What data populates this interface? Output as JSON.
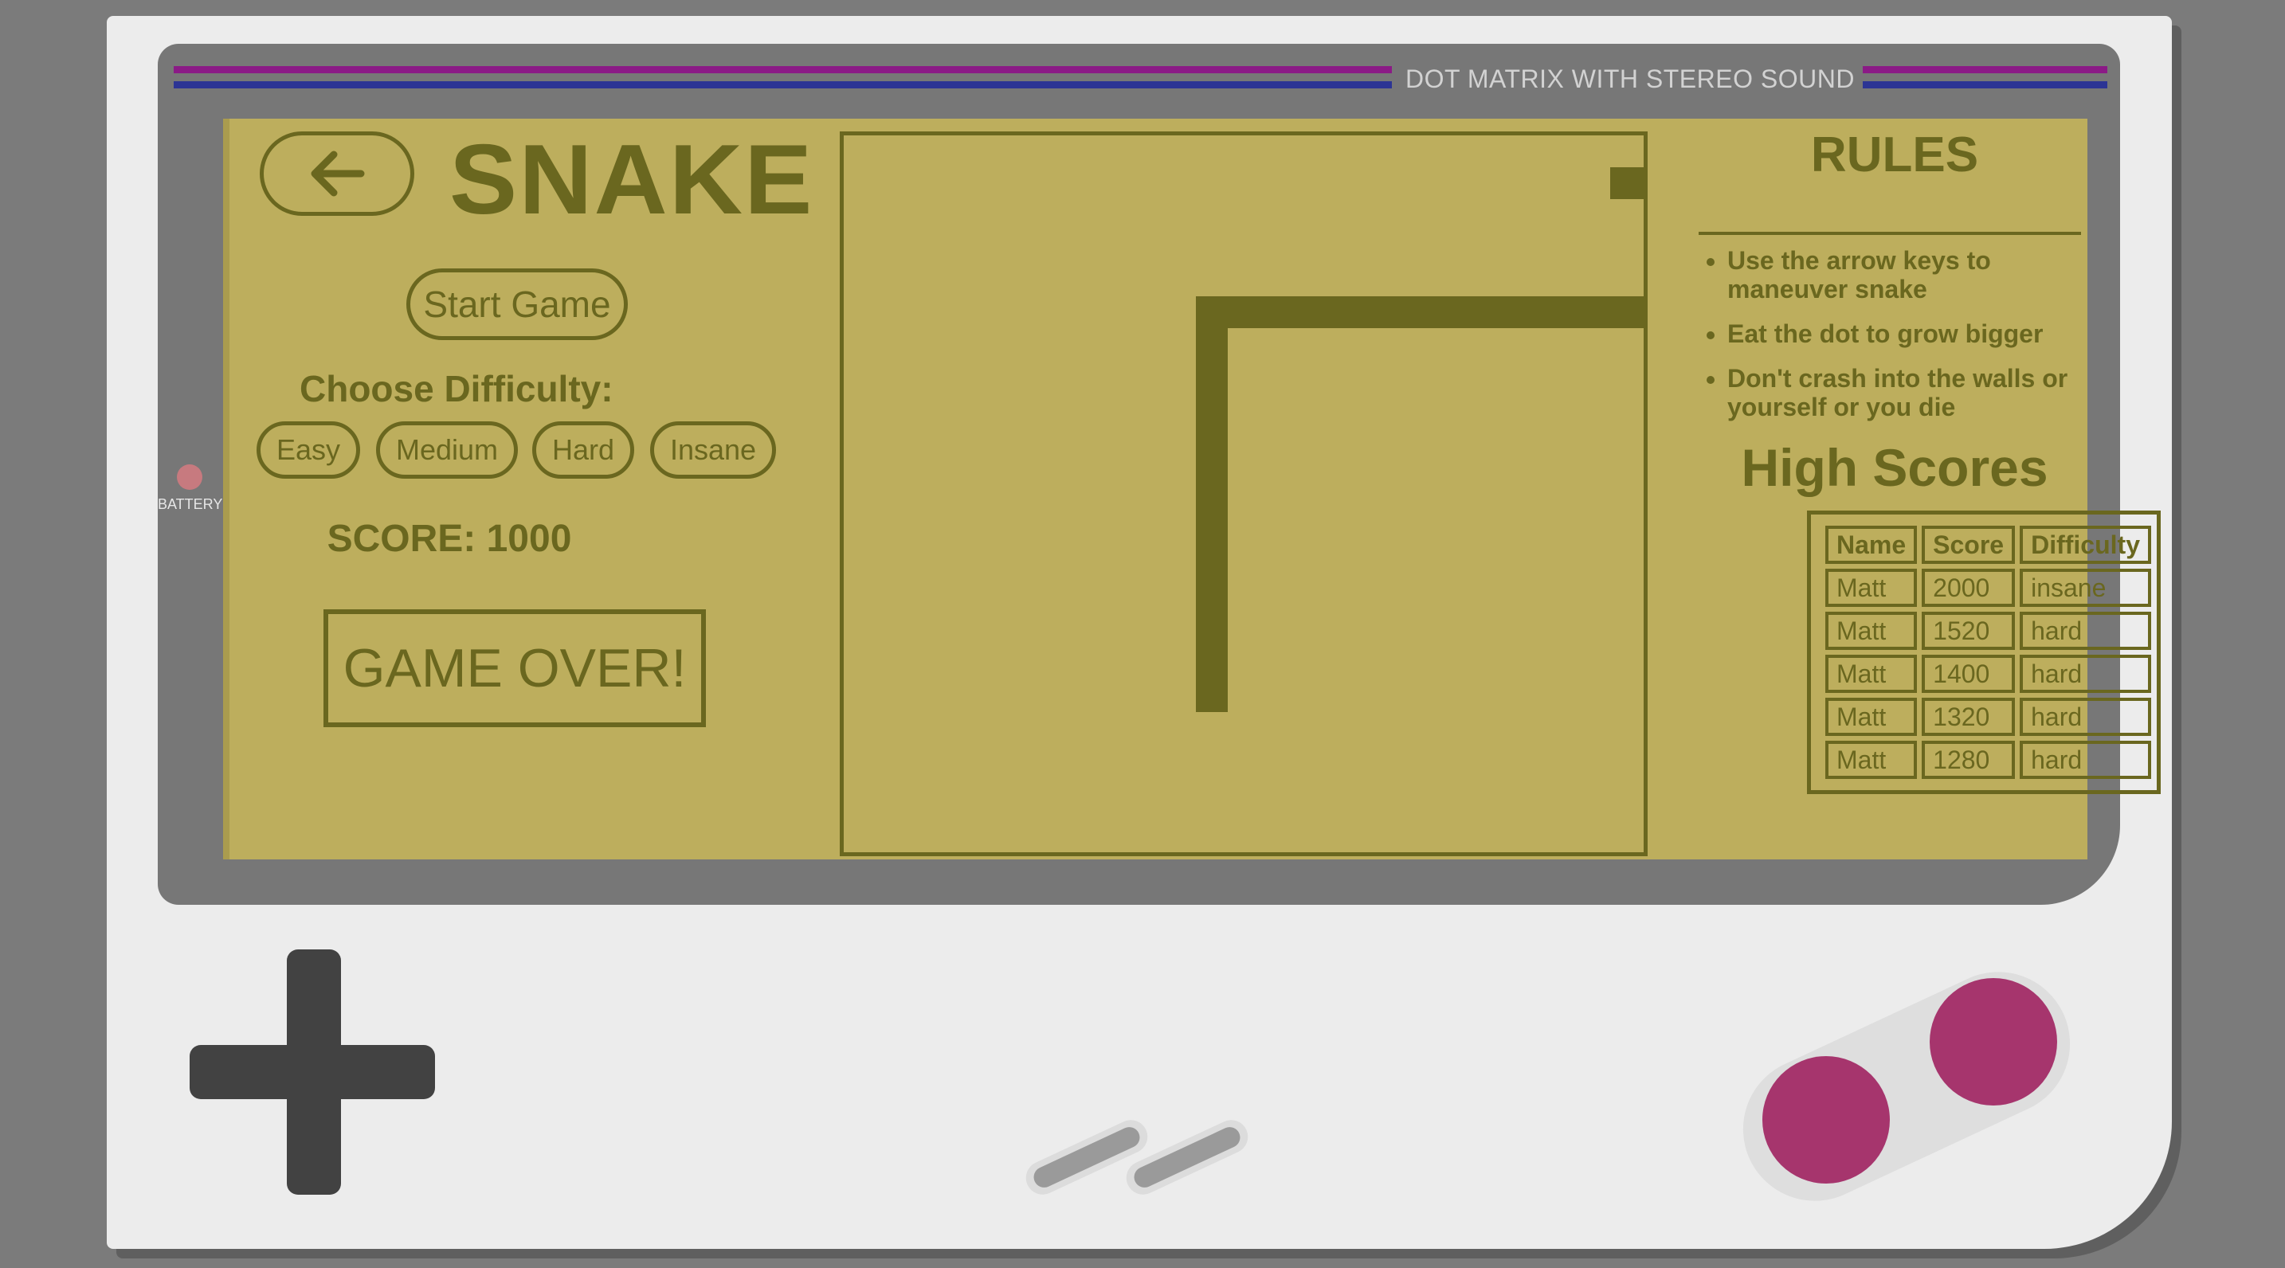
{
  "device": {
    "brand_text": "DOT MATRIX WITH STEREO SOUND",
    "battery_label": "BATTERY"
  },
  "game": {
    "title": "SNAKE",
    "start_label": "Start Game",
    "difficulty_label": "Choose Difficulty:",
    "difficulties": [
      "Easy",
      "Medium",
      "Hard",
      "Insane"
    ],
    "score_text": "SCORE: 1000",
    "status_text": "GAME OVER!"
  },
  "rules": {
    "title": "RULES",
    "items": [
      "Use the arrow keys to maneuver snake",
      "Eat the dot to grow bigger",
      "Don't crash into the walls or yourself or you die"
    ]
  },
  "high_scores": {
    "title": "High Scores",
    "columns": [
      "Name",
      "Score",
      "Difficulty"
    ],
    "rows": [
      [
        "Matt",
        "2000",
        "insane"
      ],
      [
        "Matt",
        "1520",
        "hard"
      ],
      [
        "Matt",
        "1400",
        "hard"
      ],
      [
        "Matt",
        "1320",
        "hard"
      ],
      [
        "Matt",
        "1280",
        "hard"
      ]
    ]
  },
  "colors": {
    "screen": "#bdae5d",
    "ink": "#6a671f",
    "bezel": "#777777",
    "body": "#ececec",
    "button": "#a6356d",
    "dpad": "#424242"
  }
}
